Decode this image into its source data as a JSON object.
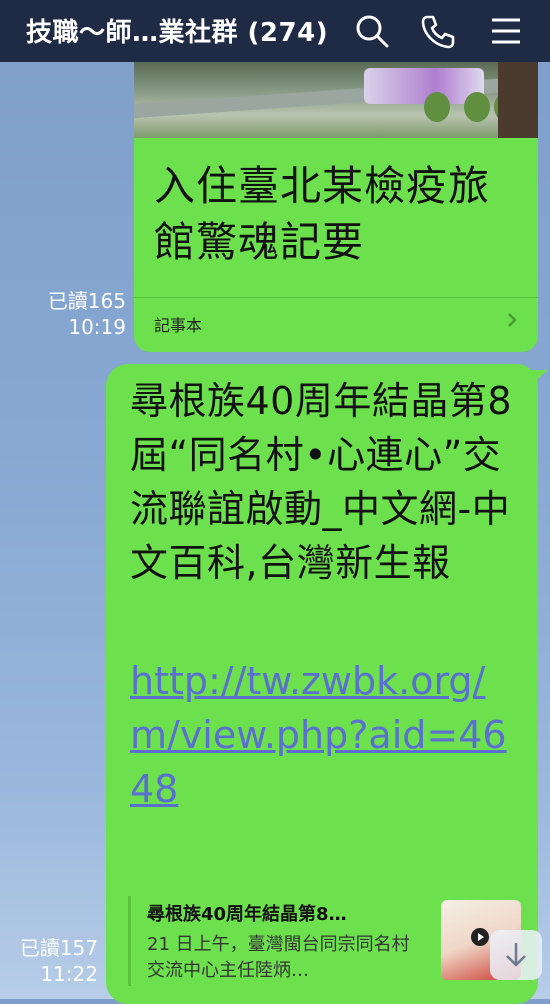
{
  "header": {
    "title": "技職～師…業社群 (274)",
    "icons": [
      "search-icon",
      "phone-icon",
      "menu-icon"
    ]
  },
  "messages": [
    {
      "type": "article-card",
      "headline": "入住臺北某檢疫旅館驚魂記要",
      "source": "記事本",
      "read_status": "已讀165",
      "time": "10:19"
    },
    {
      "type": "link-message",
      "text": "尋根族40周年結晶第8屆“同名村•心連心”交流聯誼啟動_中文網-中文百科,台灣新生報",
      "link": "http://tw.zwbk.org/m/view.php?aid=4648",
      "preview": {
        "title": "尋根族40周年結晶第8…",
        "description": "21 日上午，臺灣閩台同宗同名村交流中心主任陸炳…"
      },
      "read_status": "已讀157",
      "time": "11:22"
    }
  ],
  "colors": {
    "header_bg": "#1f2a44",
    "bubble_green": "#6de04d",
    "link_blue": "#5a6fd0"
  }
}
